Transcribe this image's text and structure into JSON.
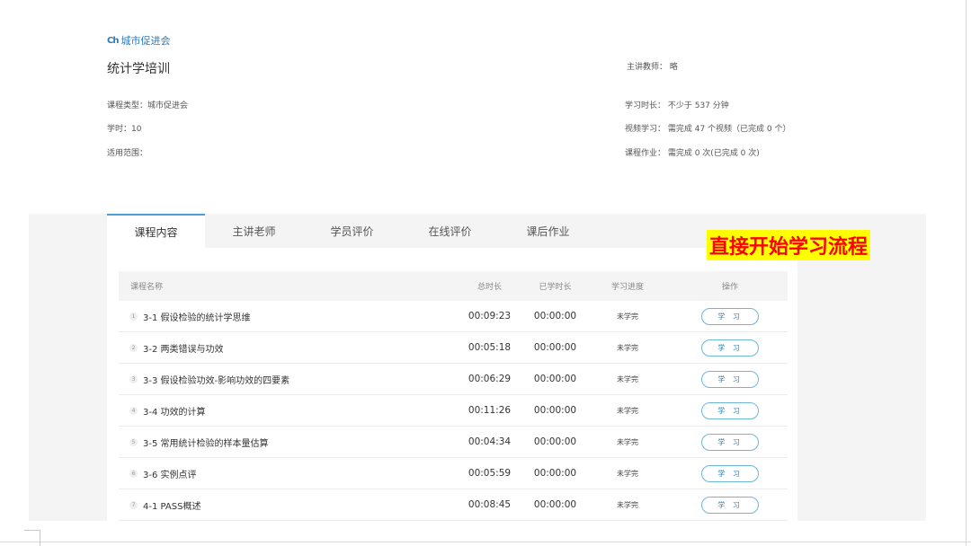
{
  "header": {
    "brand_logo": "Ch",
    "brand_name": "城市促进会",
    "course_title": "统计学培训",
    "lecturer_label": "主讲教师：",
    "lecturer_value": "略",
    "course_type": "课程类型：城市促进会",
    "hours": "学时：10",
    "scope": "适用范围：",
    "study_duration": "学习时长：  不少于 537 分钟",
    "video_study": "视频学习：  需完成 47 个视频（已完成 0 个）",
    "homework": "课程作业：  需完成 0 次(已完成 0 次)"
  },
  "tabs": [
    "课程内容",
    "主讲老师",
    "学员评价",
    "在线评价",
    "课后作业"
  ],
  "active_tab": 0,
  "table": {
    "columns": [
      "课程名称",
      "总时长",
      "已学时长",
      "学习进度",
      "操作"
    ],
    "rows": [
      {
        "index": "1",
        "name": "3-1 假设检验的统计学思维",
        "total": "00:09:23",
        "learned": "00:00:00",
        "progress": "未学完",
        "action": "学 习"
      },
      {
        "index": "2",
        "name": "3-2 两类错误与功效",
        "total": "00:05:18",
        "learned": "00:00:00",
        "progress": "未学完",
        "action": "学 习"
      },
      {
        "index": "3",
        "name": "3-3 假设检验功效-影响功效的四要素",
        "total": "00:06:29",
        "learned": "00:00:00",
        "progress": "未学完",
        "action": "学 习"
      },
      {
        "index": "4",
        "name": "3-4 功效的计算",
        "total": "00:11:26",
        "learned": "00:00:00",
        "progress": "未学完",
        "action": "学 习"
      },
      {
        "index": "5",
        "name": "3-5 常用统计检验的样本量估算",
        "total": "00:04:34",
        "learned": "00:00:00",
        "progress": "未学完",
        "action": "学 习"
      },
      {
        "index": "6",
        "name": "3-6 实例点评",
        "total": "00:05:59",
        "learned": "00:00:00",
        "progress": "未学完",
        "action": "学 习"
      },
      {
        "index": "7",
        "name": "4-1 PASS概述",
        "total": "00:08:45",
        "learned": "00:00:00",
        "progress": "未学完",
        "action": "学 习"
      }
    ]
  },
  "annotation": "直接开始学习流程",
  "colors": {
    "accent": "#2b7bb9",
    "tab_border": "#4a9fd8",
    "annotation_bg": "#ffff00",
    "annotation_text": "#ff0000"
  }
}
